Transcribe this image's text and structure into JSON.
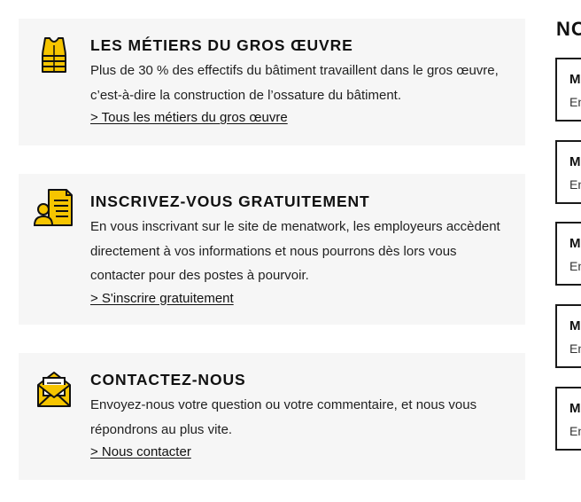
{
  "cards": [
    {
      "icon": "safety-vest-icon",
      "title": "LES MÉTIERS DU GROS ŒUVRE",
      "text": "Plus de 30 % des effectifs du bâtiment travaillent dans le gros œuvre, c’est-à-dire la construction de l’ossature du bâtiment.",
      "link": "> Tous les métiers du gros œuvre"
    },
    {
      "icon": "resume-person-icon",
      "title": "INSCRIVEZ-VOUS GRATUITEMENT",
      "text": "En vous inscrivant sur le site de menatwork, les employeurs accèdent directement à vos informations et nous pourrons dès lors vous contacter pour des postes à pourvoir.",
      "link": "> S'inscrire gratuitement"
    },
    {
      "icon": "envelope-letter-icon",
      "title": "CONTACTEZ-NOUS",
      "text": "Envoyez-nous votre question ou votre commentaire, et nous vous répondrons au plus vite.",
      "link": "> Nous contacter"
    }
  ],
  "sidebar": {
    "title": "NO",
    "items": [
      {
        "title": "M",
        "subtitle": "En"
      },
      {
        "title": "M",
        "subtitle": "En"
      },
      {
        "title": "M",
        "subtitle": "En"
      },
      {
        "title": "M",
        "subtitle": "En"
      },
      {
        "title": "M",
        "subtitle": "En"
      }
    ]
  },
  "colors": {
    "accent": "#f6c500",
    "card_bg": "#f6f6f6",
    "border": "#1a1a1a"
  }
}
